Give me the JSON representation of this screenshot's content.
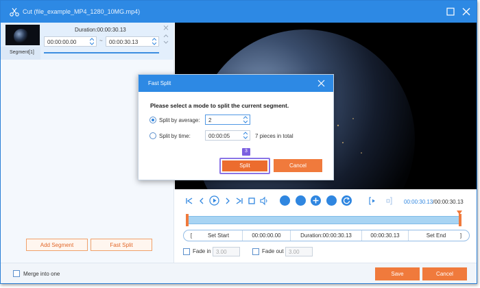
{
  "window": {
    "title": "Cut (file_example_MP4_1280_10MG.mp4)"
  },
  "segment": {
    "duration": "Duration:00:00:30.13",
    "start_time": "00:00:00.00",
    "end_time": "00:00:30.13",
    "separator": "~",
    "label": "Segment[1]"
  },
  "left_actions": {
    "add_segment": "Add Segment",
    "fast_split": "Fast Split"
  },
  "playback": {
    "current_time": "00:00:30.13",
    "total_time": "/00:00:30.13"
  },
  "set_row": {
    "left_bracket": "[",
    "set_start": "Set Start",
    "start_value": "00:00:00.00",
    "duration": "Duration:00:00:30.13",
    "end_value": "00:00:30.13",
    "set_end": "Set End",
    "right_bracket": "]"
  },
  "fade": {
    "fade_in_label": "Fade in",
    "fade_in_value": "3.00",
    "fade_out_label": "Fade out",
    "fade_out_value": "3.00"
  },
  "bottom": {
    "merge_label": "Merge into one",
    "save": "Save",
    "cancel": "Cancel"
  },
  "dialog": {
    "title": "Fast Split",
    "prompt": "Please select a mode to split the current segment.",
    "average_label": "Split by average:",
    "average_value": "2",
    "time_label": "Split by time:",
    "time_value": "00:00:05",
    "pieces_text": "7 pieces in total",
    "step_badge": "3",
    "split": "Split",
    "cancel": "Cancel",
    "selected_mode": "average"
  },
  "colors": {
    "accent_blue": "#2d89e4",
    "accent_orange": "#f07a3c",
    "highlight_purple": "#8a74e6"
  }
}
